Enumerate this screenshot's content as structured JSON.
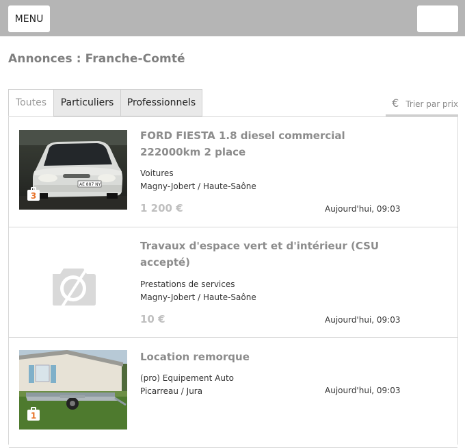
{
  "header": {
    "menu_label": "MENU"
  },
  "page": {
    "title": "Annonces : Franche-Comté"
  },
  "tabs": [
    {
      "label": "Toutes",
      "active": true
    },
    {
      "label": "Particuliers",
      "active": false
    },
    {
      "label": "Professionnels",
      "active": false
    }
  ],
  "sort": {
    "currency_symbol": "€",
    "label": "Trier par prix"
  },
  "listings": [
    {
      "title": "FORD FIESTA 1.8 diesel commercial 222000km 2 place",
      "category": "Voitures",
      "location": "Magny-Jobert / Haute-Saône",
      "price": "1 200 €",
      "date": "Aujourd'hui, 09:03",
      "photo_count": "3",
      "image": "white-car-photo"
    },
    {
      "title": "Travaux d'espace vert et d'intérieur (CSU accepté)",
      "category": "Prestations de services",
      "location": "Magny-Jobert / Haute-Saône",
      "price": "10 €",
      "date": "Aujourd'hui, 09:03",
      "image": "no-photo-camera-icon"
    },
    {
      "title": "Location remorque",
      "category": "(pro) Equipement Auto",
      "location": "Picarreau / Jura",
      "date": "Aujourd'hui, 09:03",
      "photo_count": "1",
      "image": "trailer-photo"
    }
  ]
}
